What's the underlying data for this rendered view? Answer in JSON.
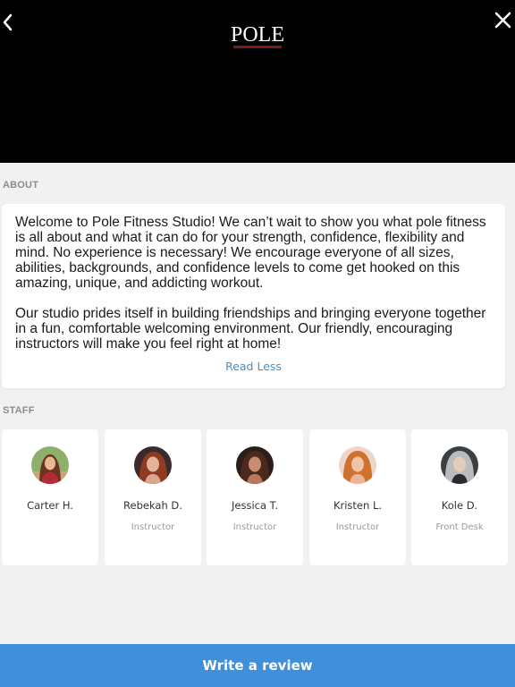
{
  "header": {
    "logo_text": "POLE"
  },
  "about": {
    "section_label": "ABOUT",
    "paragraphs": [
      "Welcome to Pole Fitness Studio! We can’t wait to show you what pole fitness is all about and what it can do for your strength, confidence, flexibility and mind. No experience is necessary! We encourage everyone of all sizes, abilities, backgrounds, and confidence levels to come get hooked on this amazing, unique, and addicting workout.",
      "Our studio prides itself in building friendships and bringing everyone together in a fun, comfortable welcoming environment. Our friendly, encouraging instructors will make you feel right at home!"
    ],
    "read_less_label": "Read Less"
  },
  "staff": {
    "section_label": "STAFF",
    "members": [
      {
        "name": "Carter H.",
        "role": ""
      },
      {
        "name": "Rebekah D.",
        "role": "Instructor"
      },
      {
        "name": "Jessica T.",
        "role": "Instructor"
      },
      {
        "name": "Kristen L.",
        "role": "Instructor"
      },
      {
        "name": "Kole D.",
        "role": "Front Desk"
      }
    ]
  },
  "footer": {
    "review_button_label": "Write a review"
  },
  "colors": {
    "header_bg": "#010101",
    "page_bg": "#f1f1f2",
    "accent_link": "#4a90c8",
    "review_button_bg": "#3f8fdb"
  }
}
